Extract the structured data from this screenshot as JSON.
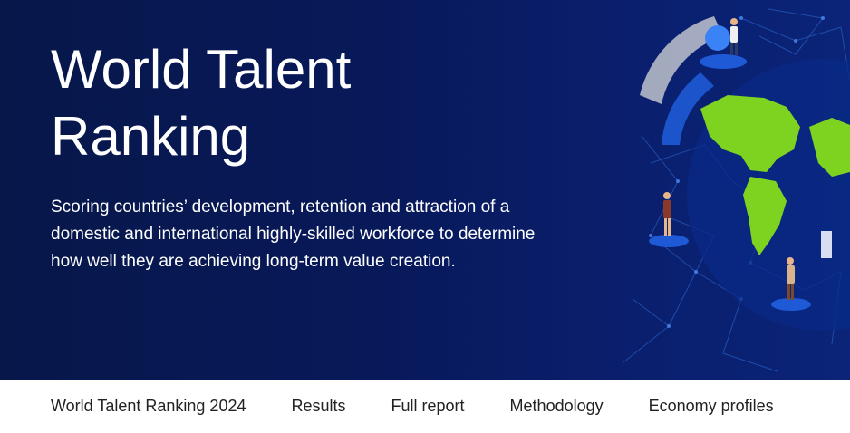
{
  "hero": {
    "title": "World Talent Ranking",
    "description": "Scoring countries’ development, retention and attraction of a domestic and international highly-skilled workforce to determine how well they are achieving long-term value creation."
  },
  "nav": {
    "items": [
      {
        "label": "World Talent Ranking 2024"
      },
      {
        "label": "Results"
      },
      {
        "label": "Full report"
      },
      {
        "label": "Methodology"
      },
      {
        "label": "Economy profiles"
      }
    ]
  },
  "colors": {
    "hero_dark": "#07174a",
    "hero_mid": "#0a1f6e",
    "continent_green": "#7ed321",
    "network_blue": "#2f6fd8",
    "nav_text": "#222222"
  },
  "illustration": {
    "name": "globe-network-illustration"
  }
}
